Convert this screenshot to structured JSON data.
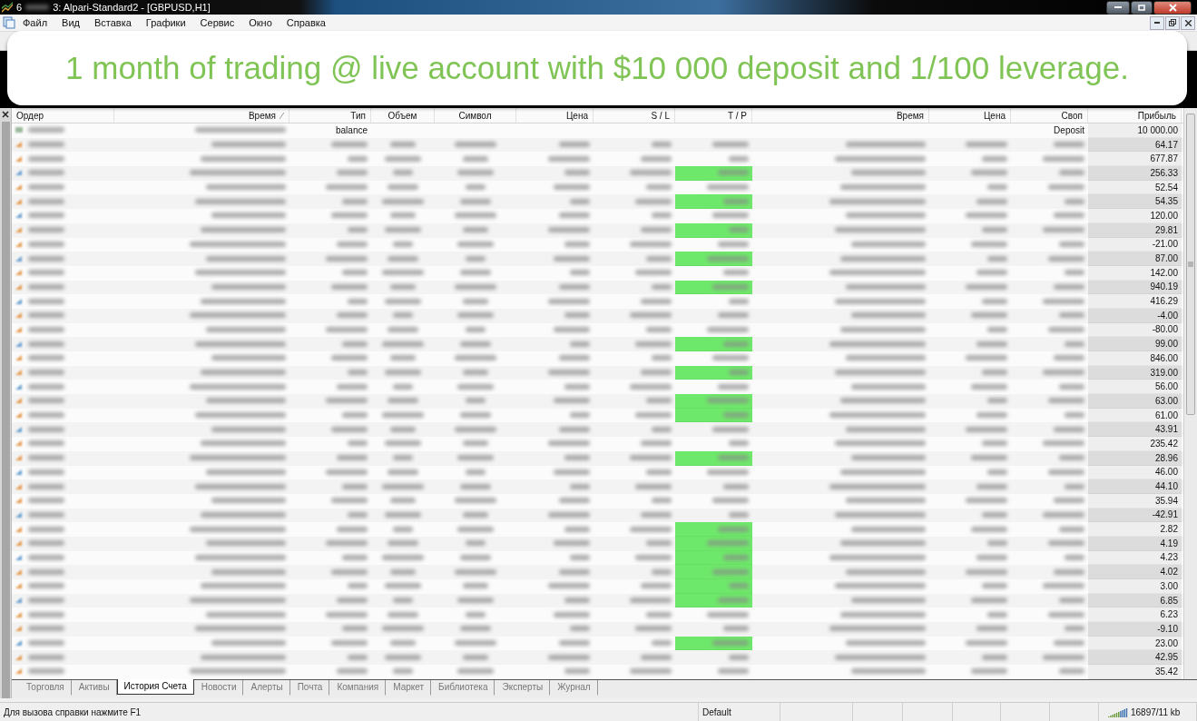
{
  "window": {
    "title_prefix": "6",
    "title": "3: Alpari-Standard2 - [GBPUSD,H1]"
  },
  "menu": [
    "Файл",
    "Вид",
    "Вставка",
    "Графики",
    "Сервис",
    "Окно",
    "Справка"
  ],
  "banner": {
    "text": "1 month of trading @ live account with $10 000 deposit and 1/100 leverage."
  },
  "table": {
    "columns": [
      {
        "label": "Ордер",
        "sorted": false
      },
      {
        "label": "Время",
        "sorted": true
      },
      {
        "label": "Тип",
        "sorted": false
      },
      {
        "label": "Объем",
        "sorted": false
      },
      {
        "label": "Символ",
        "sorted": false
      },
      {
        "label": "Цена",
        "sorted": false
      },
      {
        "label": "S / L",
        "sorted": false
      },
      {
        "label": "T / P",
        "sorted": false
      },
      {
        "label": "Время",
        "sorted": false
      },
      {
        "label": "Цена",
        "sorted": false
      },
      {
        "label": "Своп",
        "sorted": false
      },
      {
        "label": "Прибыль",
        "sorted": false
      }
    ],
    "rows": [
      {
        "kind": "balance",
        "type": "balance",
        "swap": "Deposit",
        "profit": "10 000.00"
      },
      {
        "kind": "trade",
        "profit": "64.17",
        "tp_hit": false
      },
      {
        "kind": "trade",
        "profit": "677.87",
        "tp_hit": false
      },
      {
        "kind": "trade",
        "profit": "256.33",
        "tp_hit": true
      },
      {
        "kind": "trade",
        "profit": "52.54",
        "tp_hit": false
      },
      {
        "kind": "trade",
        "profit": "54.35",
        "tp_hit": true
      },
      {
        "kind": "trade",
        "profit": "120.00",
        "tp_hit": false
      },
      {
        "kind": "trade",
        "profit": "29.81",
        "tp_hit": true
      },
      {
        "kind": "trade",
        "profit": "-21.00",
        "tp_hit": false
      },
      {
        "kind": "trade",
        "profit": "87.00",
        "tp_hit": true
      },
      {
        "kind": "trade",
        "profit": "142.00",
        "tp_hit": false
      },
      {
        "kind": "trade",
        "profit": "940.19",
        "tp_hit": true
      },
      {
        "kind": "trade",
        "profit": "416.29",
        "tp_hit": false
      },
      {
        "kind": "trade",
        "profit": "-4.00",
        "tp_hit": false
      },
      {
        "kind": "trade",
        "profit": "-80.00",
        "tp_hit": false
      },
      {
        "kind": "trade",
        "profit": "99.00",
        "tp_hit": true
      },
      {
        "kind": "trade",
        "profit": "846.00",
        "tp_hit": false
      },
      {
        "kind": "trade",
        "profit": "319.00",
        "tp_hit": true
      },
      {
        "kind": "trade",
        "profit": "56.00",
        "tp_hit": false
      },
      {
        "kind": "trade",
        "profit": "63.00",
        "tp_hit": true
      },
      {
        "kind": "trade",
        "profit": "61.00",
        "tp_hit": true
      },
      {
        "kind": "trade",
        "profit": "43.91",
        "tp_hit": false
      },
      {
        "kind": "trade",
        "profit": "235.42",
        "tp_hit": false
      },
      {
        "kind": "trade",
        "profit": "28.96",
        "tp_hit": true
      },
      {
        "kind": "trade",
        "profit": "46.00",
        "tp_hit": false
      },
      {
        "kind": "trade",
        "profit": "44.10",
        "tp_hit": false
      },
      {
        "kind": "trade",
        "profit": "35.94",
        "tp_hit": false
      },
      {
        "kind": "trade",
        "profit": "-42.91",
        "tp_hit": false
      },
      {
        "kind": "trade",
        "profit": "2.82",
        "tp_hit": true
      },
      {
        "kind": "trade",
        "profit": "4.19",
        "tp_hit": true
      },
      {
        "kind": "trade",
        "profit": "4.23",
        "tp_hit": true
      },
      {
        "kind": "trade",
        "profit": "4.02",
        "tp_hit": true
      },
      {
        "kind": "trade",
        "profit": "3.00",
        "tp_hit": true
      },
      {
        "kind": "trade",
        "profit": "6.85",
        "tp_hit": true
      },
      {
        "kind": "trade",
        "profit": "6.23",
        "tp_hit": false
      },
      {
        "kind": "trade",
        "profit": "-9.10",
        "tp_hit": false
      },
      {
        "kind": "trade",
        "profit": "23.00",
        "tp_hit": true
      },
      {
        "kind": "trade",
        "profit": "42.95",
        "tp_hit": false
      },
      {
        "kind": "trade",
        "profit": "35.42",
        "tp_hit": false
      }
    ]
  },
  "tabs": [
    {
      "label": "Торговля",
      "selected": false
    },
    {
      "label": "Активы",
      "selected": false
    },
    {
      "label": "История Счета",
      "selected": true
    },
    {
      "label": "Новости",
      "selected": false
    },
    {
      "label": "Алерты",
      "selected": false
    },
    {
      "label": "Почта",
      "selected": false
    },
    {
      "label": "Компания",
      "selected": false
    },
    {
      "label": "Маркет",
      "selected": false
    },
    {
      "label": "Библиотека",
      "selected": false
    },
    {
      "label": "Эксперты",
      "selected": false
    },
    {
      "label": "Журнал",
      "selected": false
    }
  ],
  "status_bar": {
    "hint": "Для вызова справки нажмите F1",
    "profile": "Default",
    "traffic": "16897/11 kb"
  }
}
